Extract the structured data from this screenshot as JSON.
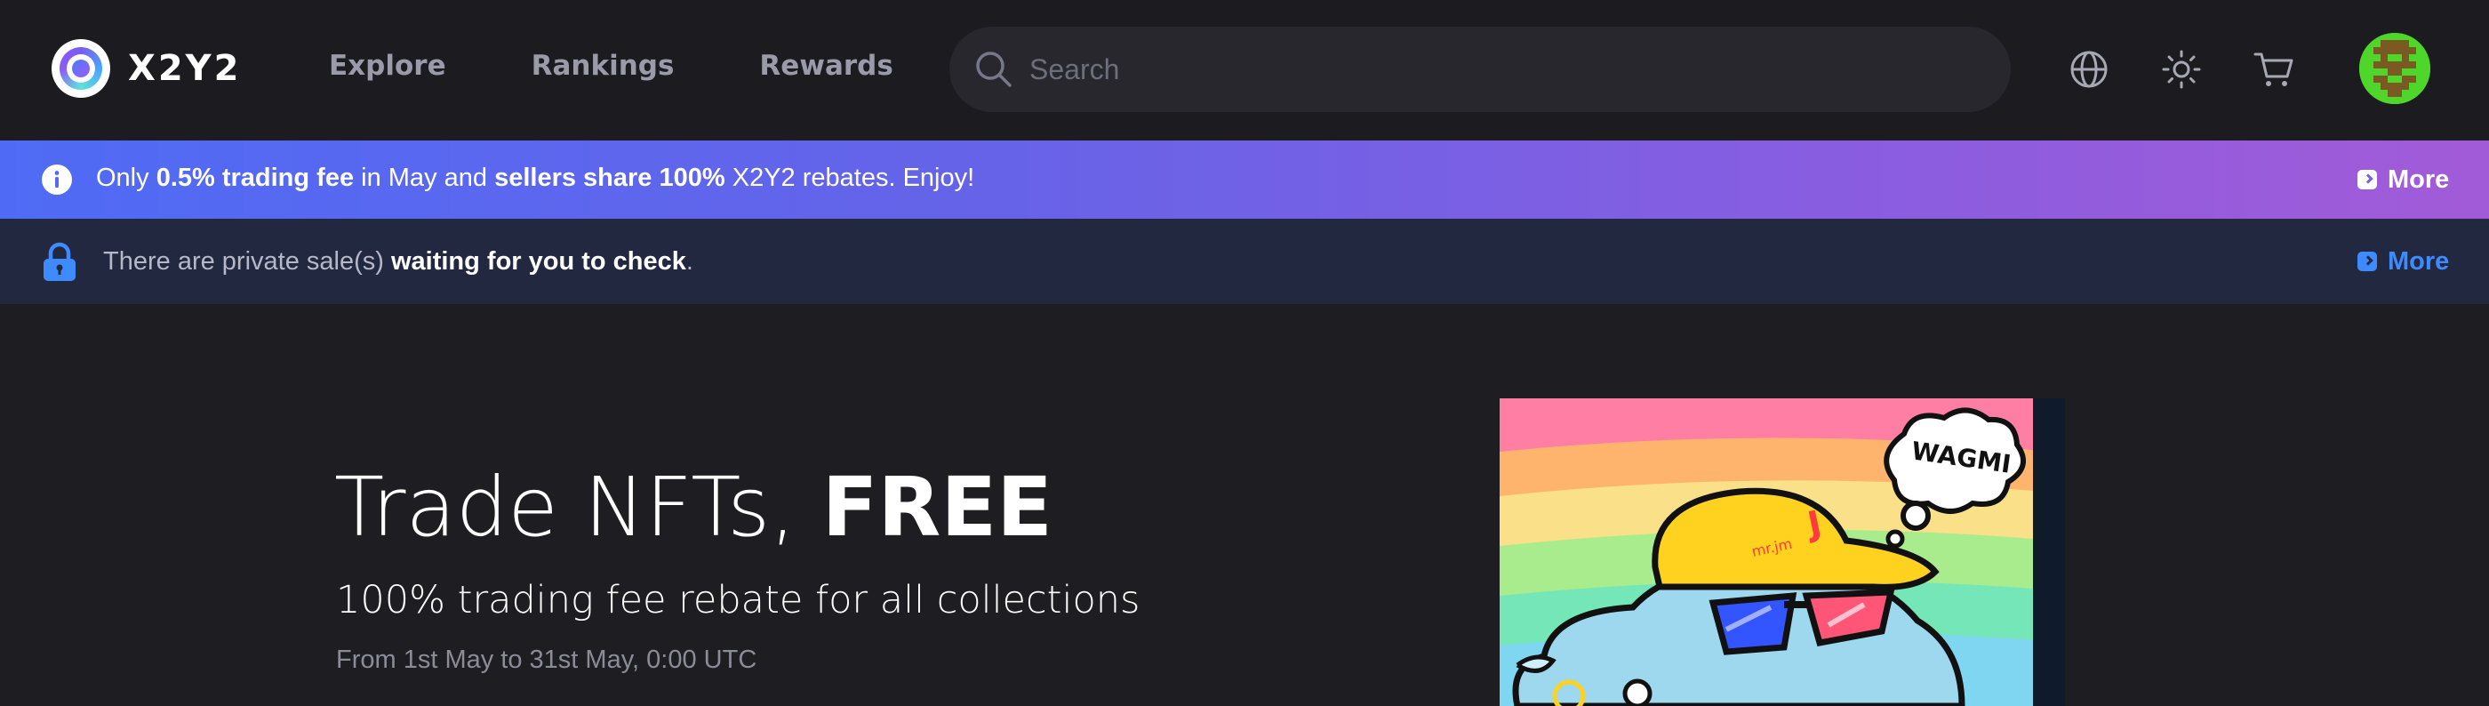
{
  "header": {
    "logo_text": "X2Y2",
    "nav": [
      "Explore",
      "Rankings",
      "Rewards"
    ],
    "search_placeholder": "Search",
    "icons": [
      "globe-icon",
      "sun-icon",
      "cart-icon"
    ]
  },
  "promo_banner": {
    "parts": [
      "Only ",
      "0.5% trading fee",
      " in May and ",
      "sellers share 100%",
      " X2Y2 rebates. Enjoy!"
    ],
    "more_label": "More"
  },
  "private_banner": {
    "parts": [
      "There are private sale(s) ",
      "waiting for you to check",
      "."
    ],
    "more_label": "More"
  },
  "hero": {
    "title_light": "Trade NFTs, ",
    "title_bold": "FREE",
    "subtitle": "100% trading fee rebate for all collections",
    "date_range": "From 1st May to 31st May, 0:00 UTC"
  },
  "artwork": {
    "bubble_text": "WAGMI",
    "cap_letter": "J",
    "cap_signature": "mr.jm"
  },
  "colors": {
    "background": "#1e1d22",
    "header": "#1c1b20",
    "promo_start": "#4f6bf5",
    "promo_end": "#a25bd8",
    "private_bar": "#222840",
    "accent_blue": "#3d8bff"
  }
}
